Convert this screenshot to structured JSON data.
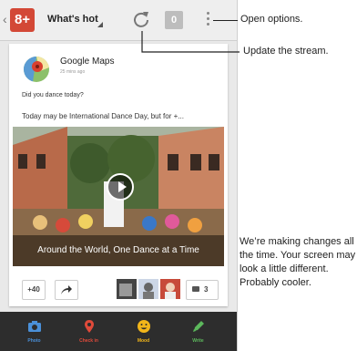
{
  "topbar": {
    "app_badge": "8+",
    "stream_title": "What's hot",
    "count": "0"
  },
  "post": {
    "author": "Google Maps",
    "time": "25 mins ago",
    "prompt": "Did you dance today?",
    "headline": "Today may be International Dance Day, but for +...",
    "media_caption": "Around the World, One Dance at a Time",
    "plus_count": "+40",
    "comment_count": "3"
  },
  "bottom_nav": [
    {
      "label": "Photo",
      "color": "#4a90d9"
    },
    {
      "label": "Check in",
      "color": "#e04a3a"
    },
    {
      "label": "Mood",
      "color": "#f2b61a"
    },
    {
      "label": "Write",
      "color": "#5cb85c"
    }
  ],
  "callouts": {
    "open_options": "Open options.",
    "update_stream": "Update the stream.",
    "side_note": "We’re making changes all the time. Your screen may look a little different. Probably cooler."
  },
  "colors": {
    "gplus_red": "#d34836",
    "bottom_bar": "#2d2d2d"
  }
}
